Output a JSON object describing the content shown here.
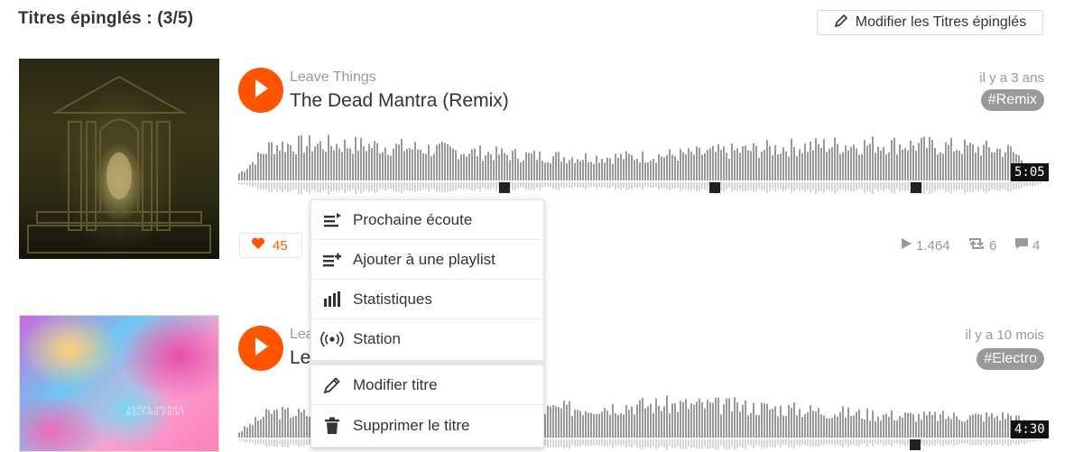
{
  "section": {
    "title": "Titres épinglés : (3/5)",
    "edit_button": "Modifier les Titres épinglés"
  },
  "tracks": [
    {
      "artist": "Leave Things",
      "title": "The Dead Mantra (Remix)",
      "time": "il y a 3 ans",
      "tag": "#Remix",
      "duration": "5:05",
      "likes": "45",
      "plays": "1.464",
      "reposts": "6",
      "comments": "4"
    },
    {
      "artist_visible": "Lea",
      "title_visible": "Le",
      "time": "il y a 10 mois",
      "tag": "#Electro",
      "duration": "4:30",
      "cover_text": "LEAVE THINGS\nMELTING POINT"
    }
  ],
  "menu": {
    "items": [
      {
        "label": "Prochaine écoute",
        "icon": "next-up-icon"
      },
      {
        "label": "Ajouter à une playlist",
        "icon": "add-to-playlist-icon"
      },
      {
        "label": "Statistiques",
        "icon": "stats-icon"
      },
      {
        "label": "Station",
        "icon": "station-icon"
      },
      {
        "label": "Modifier titre",
        "icon": "pencil-icon"
      },
      {
        "label": "Supprimer le titre",
        "icon": "trash-icon"
      }
    ]
  },
  "colors": {
    "accent": "#ff5500",
    "wave": "#999999",
    "tag_bg": "#999999",
    "text_muted": "#999999"
  }
}
